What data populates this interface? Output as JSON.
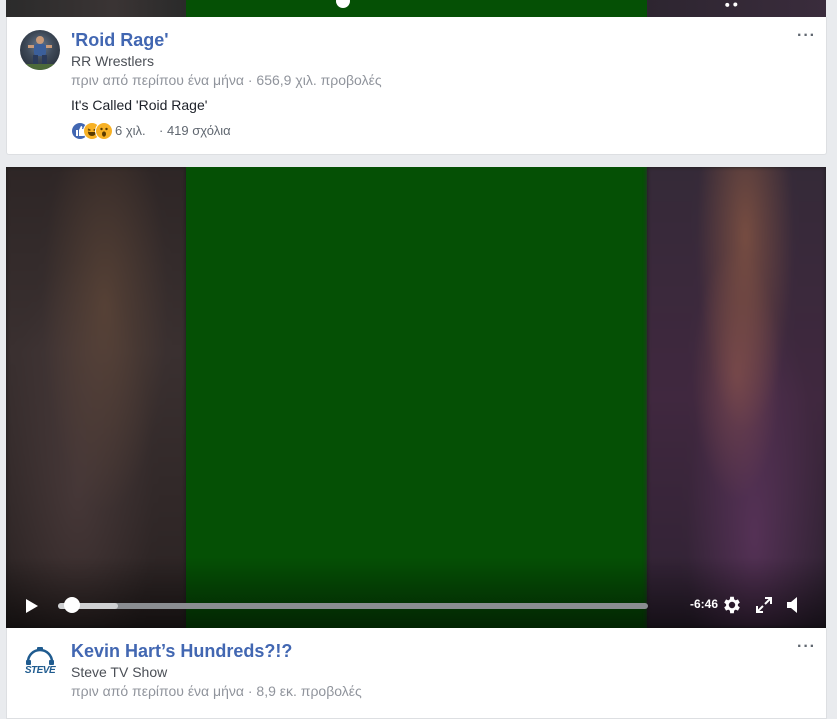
{
  "post1": {
    "title": "'Roid Rage'",
    "page_name": "RR Wrestlers",
    "meta": "πριν από περίπου ένα μήνα · 656,9 χιλ. προβολές",
    "description": "It's Called 'Roid Rage'",
    "reactions_count": "6 χιλ.",
    "comments": "· 419 σχόλια",
    "more": "···"
  },
  "video": {
    "time_remaining": "-6:46",
    "progress_buffered": 0.05,
    "progress_played": 0.01
  },
  "post2": {
    "title": "Kevin Hart’s Hundreds?!?",
    "page_name": "Steve TV Show",
    "meta": "πριν από περίπου ένα μήνα · 8,9 εκ. προβολές",
    "avatar_text": "STEVE",
    "more": "···"
  },
  "colors": {
    "link_blue": "#4267b2",
    "video_green": "#055005",
    "feed_background": "#e9ebee"
  }
}
